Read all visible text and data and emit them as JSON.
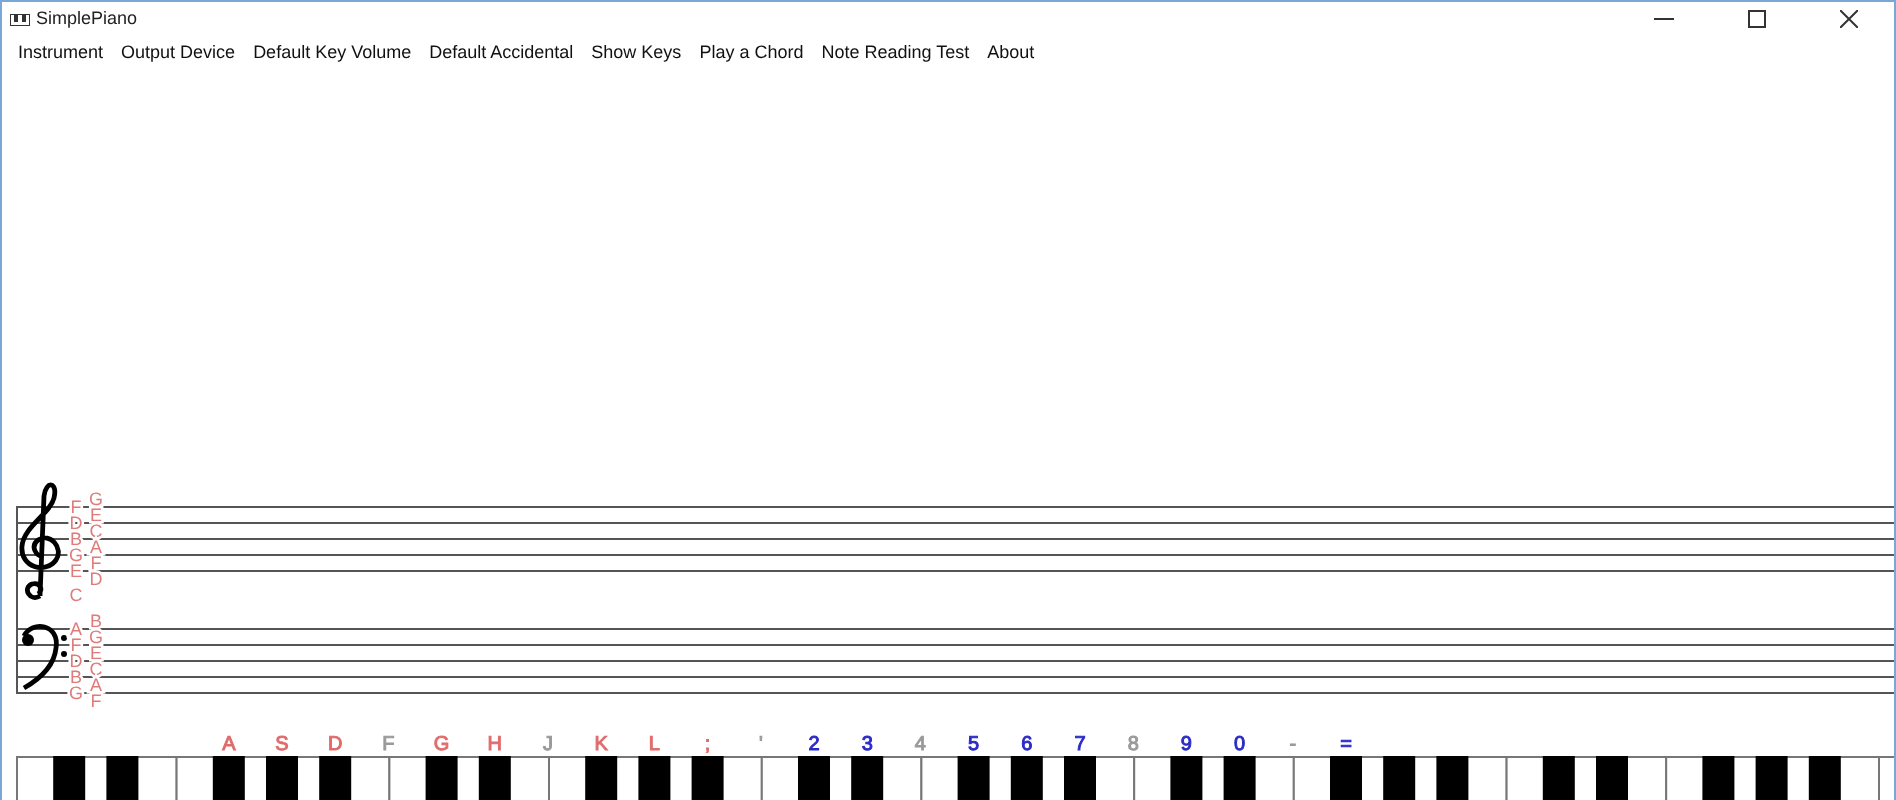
{
  "window": {
    "title": "SimplePiano"
  },
  "menu": [
    {
      "label": "Instrument"
    },
    {
      "label": "Output Device"
    },
    {
      "label": "Default Key Volume"
    },
    {
      "label": "Default Accidental"
    },
    {
      "label": "Show Keys"
    },
    {
      "label": "Play a Chord"
    },
    {
      "label": "Note Reading Test"
    },
    {
      "label": "About"
    }
  ],
  "staff": {
    "treble": {
      "line_notes": [
        "F",
        "D",
        "B",
        "G",
        "E"
      ],
      "space_notes": [
        "G",
        "E",
        "C",
        "A",
        "F",
        "D"
      ]
    },
    "middle_note": "C",
    "bass": {
      "line_notes": [
        "A",
        "F",
        "D",
        "B",
        "G"
      ],
      "space_notes": [
        "B",
        "G",
        "E",
        "C",
        "A",
        "F"
      ]
    }
  },
  "key_labels": [
    {
      "label": "A",
      "color": "#e06c6c"
    },
    {
      "label": "S",
      "color": "#e06c6c"
    },
    {
      "label": "D",
      "color": "#e06c6c"
    },
    {
      "label": "F",
      "color": "#9a9a9a"
    },
    {
      "label": "G",
      "color": "#e06c6c"
    },
    {
      "label": "H",
      "color": "#e06c6c"
    },
    {
      "label": "J",
      "color": "#9a9a9a"
    },
    {
      "label": "K",
      "color": "#e06c6c"
    },
    {
      "label": "L",
      "color": "#e06c6c"
    },
    {
      "label": ";",
      "color": "#e06c6c"
    },
    {
      "label": "'",
      "color": "#9a9a9a"
    },
    {
      "label": "2",
      "color": "#2b2bc8"
    },
    {
      "label": "3",
      "color": "#2b2bc8"
    },
    {
      "label": "4",
      "color": "#9a9a9a"
    },
    {
      "label": "5",
      "color": "#2b2bc8"
    },
    {
      "label": "6",
      "color": "#2b2bc8"
    },
    {
      "label": "7",
      "color": "#2b2bc8"
    },
    {
      "label": "8",
      "color": "#9a9a9a"
    },
    {
      "label": "9",
      "color": "#2b2bc8"
    },
    {
      "label": "0",
      "color": "#2b2bc8"
    },
    {
      "label": "-",
      "color": "#9a9a9a"
    },
    {
      "label": "=",
      "color": "#2b2bc8"
    }
  ]
}
